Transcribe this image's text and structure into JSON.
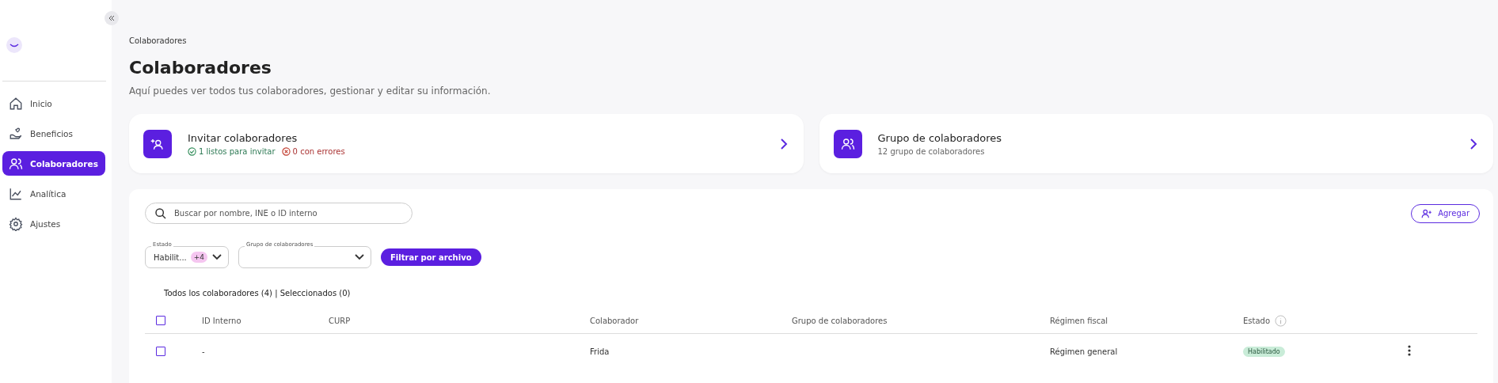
{
  "sidebar": {
    "items": [
      {
        "label": "Inicio",
        "selected": false
      },
      {
        "label": "Beneficios",
        "selected": false
      },
      {
        "label": "Colaboradores",
        "selected": true
      },
      {
        "label": "Analítica",
        "selected": false
      },
      {
        "label": "Ajustes",
        "selected": false
      }
    ]
  },
  "breadcrumb": "Colaboradores",
  "title": "Colaboradores",
  "subtitle": "Aquí puedes ver todos tus colaboradores, gestionar y editar su información.",
  "cards": [
    {
      "kind": "invite",
      "title": "Invitar colaboradores",
      "ok": "1 listos para invitar",
      "errors": "0 con errores"
    },
    {
      "kind": "group",
      "title": "Grupo de colaboradores",
      "subtitle": "12 grupo de colaboradores"
    }
  ],
  "search": {
    "placeholder": "Buscar por nombre, INE o ID interno"
  },
  "add_button": "Agregar",
  "filters": [
    {
      "label": "Estado",
      "value": "Habilit...",
      "badge": "+4"
    },
    {
      "label": "Grupo de colaboradores"
    }
  ],
  "filter_file_button": "Filtrar por archivo",
  "summary": "Todos los colaboradores (4) | Seleccionados (0)",
  "table": {
    "columns": [
      "ID Interno",
      "CURP",
      "Colaborador",
      "Grupo de colaboradores",
      "Régimen fiscal",
      "Estado"
    ],
    "header_checked": false,
    "rows": [
      {
        "checked": false,
        "id": "-",
        "curp": "",
        "name": "Frida",
        "group": "",
        "regime": "Régimen general",
        "status": "Habilitado"
      }
    ]
  }
}
